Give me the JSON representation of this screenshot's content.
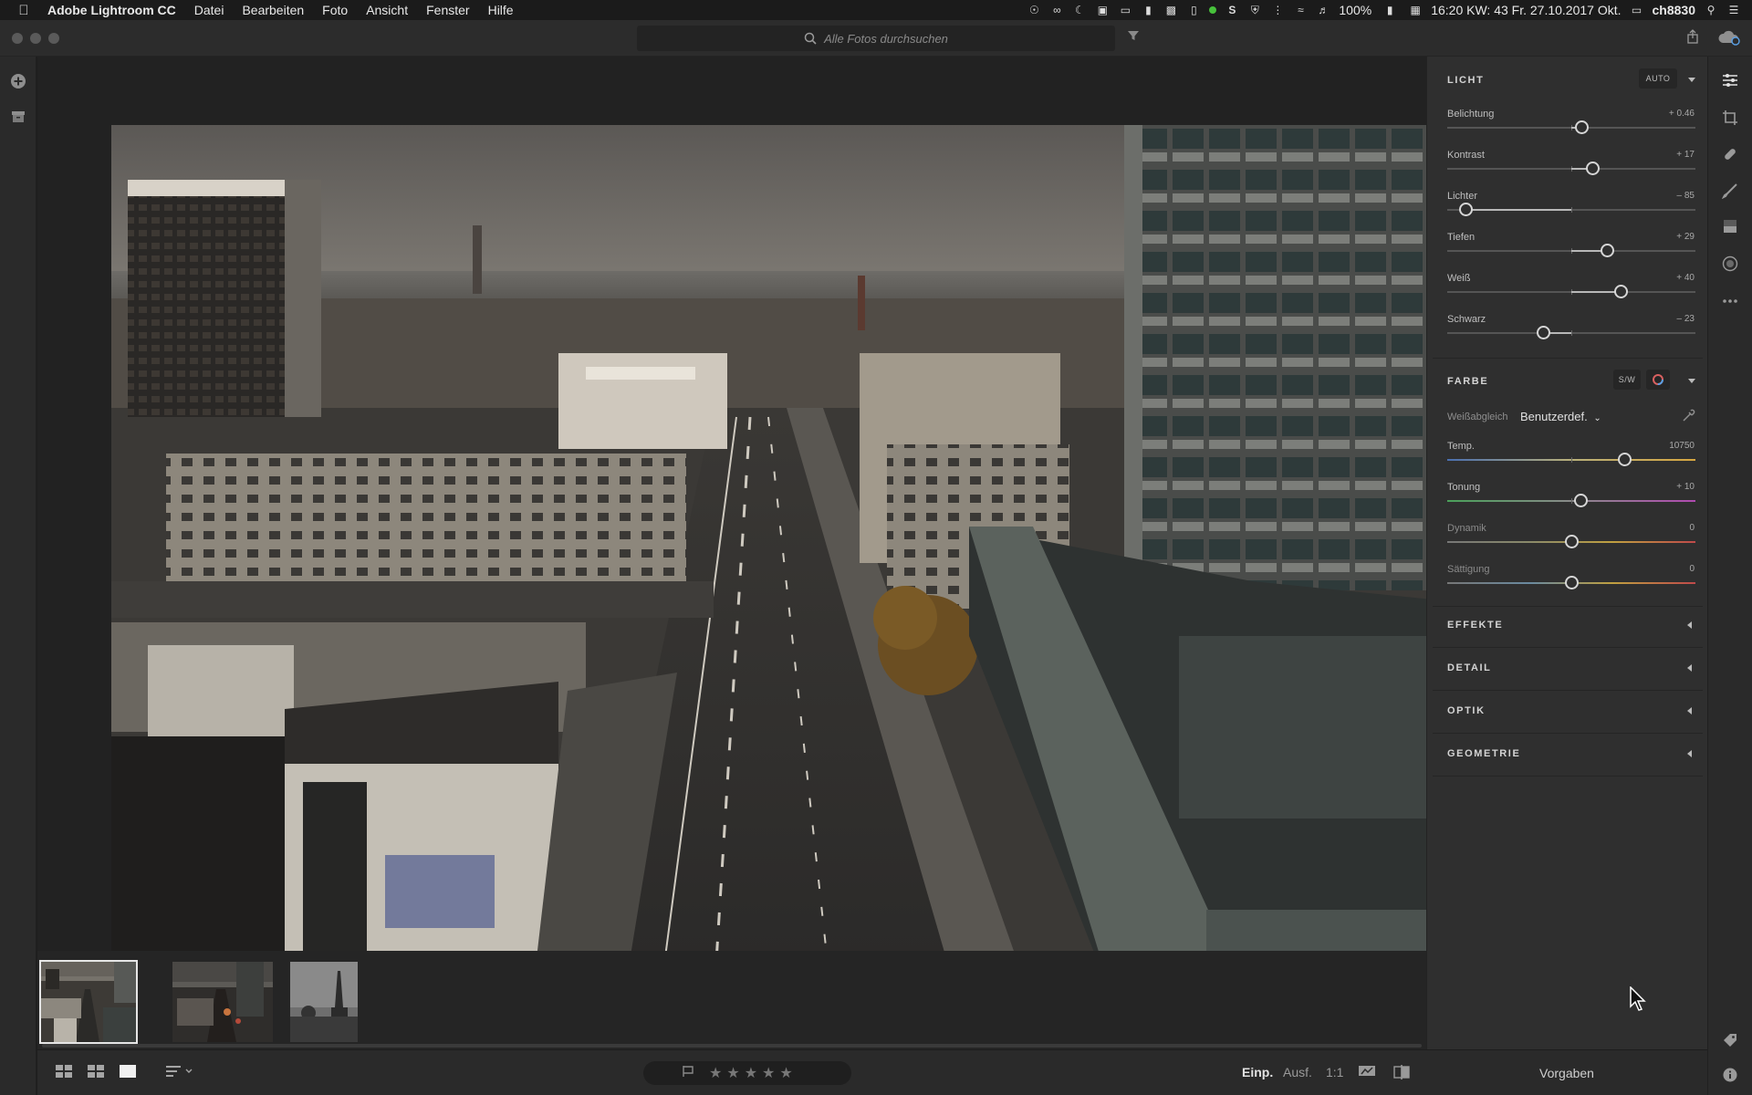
{
  "menubar": {
    "app_name": "Adobe Lightroom CC",
    "menus": [
      "Datei",
      "Bearbeiten",
      "Foto",
      "Ansicht",
      "Fenster",
      "Hilfe"
    ],
    "battery": "100%",
    "clock": "16:20 KW: 43 Fr. 27.10.2017 Okt.",
    "user": "ch8830"
  },
  "search": {
    "placeholder": "Alle Fotos durchsuchen"
  },
  "edit_panel": {
    "licht": {
      "title": "LICHT",
      "auto_label": "AUTO",
      "sliders": [
        {
          "label": "Belichtung",
          "value": "+ 0.46",
          "position": 0.54
        },
        {
          "label": "Kontrast",
          "value": "+ 17",
          "position": 0.585
        },
        {
          "label": "Lichter",
          "value": "– 85",
          "position": 0.075
        },
        {
          "label": "Tiefen",
          "value": "+ 29",
          "position": 0.645
        },
        {
          "label": "Weiß",
          "value": "+ 40",
          "position": 0.7
        },
        {
          "label": "Schwarz",
          "value": "– 23",
          "position": 0.385
        }
      ]
    },
    "farbe": {
      "title": "FARBE",
      "bw_label": "S/W",
      "wb_label": "Weißabgleich",
      "wb_value": "Benutzerdef.",
      "sliders": [
        {
          "label": "Temp.",
          "value": "10750",
          "position": 0.715
        },
        {
          "label": "Tonung",
          "value": "+ 10",
          "position": 0.535
        },
        {
          "label": "Dynamik",
          "value": "0",
          "position": 0.5
        },
        {
          "label": "Sättigung",
          "value": "0",
          "position": 0.5
        }
      ]
    },
    "collapsed_sections": [
      "EFFEKTE",
      "DETAIL",
      "OPTIK",
      "GEOMETRIE"
    ]
  },
  "bottom_bar": {
    "einp": "Einp.",
    "ausf": "Ausf.",
    "ratio": "1:1",
    "vorgaben": "Vorgaben"
  },
  "icons": {
    "add": "plus-circle-icon",
    "archive": "archive-icon",
    "search": "search-icon",
    "filter": "filter-icon",
    "share": "share-icon",
    "cloud": "cloud-sync-icon",
    "edit": "sliders-icon",
    "crop": "crop-icon",
    "heal": "healing-brush-icon",
    "brush": "brush-icon",
    "gradient": "linear-gradient-icon",
    "radial": "radial-gradient-icon",
    "more": "more-icon",
    "tag": "tag-icon",
    "info": "info-icon"
  },
  "colors": {
    "panel_bg": "#2f2f2f",
    "app_bg": "#222222",
    "accent_text": "#d4d4d4"
  }
}
